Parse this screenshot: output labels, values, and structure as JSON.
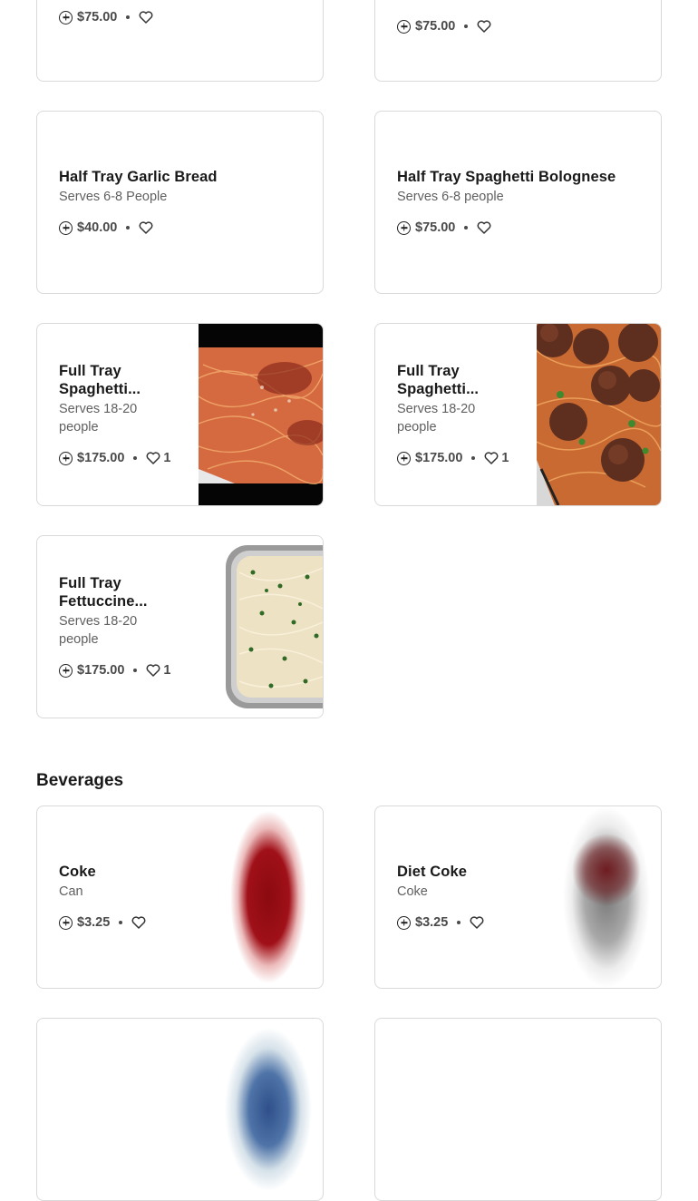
{
  "items": [
    {
      "price": "$75.00"
    },
    {
      "price": "$75.00"
    },
    {
      "title": "Half Tray Garlic Bread",
      "desc": "Serves 6-8 People",
      "price": "$40.00"
    },
    {
      "title": "Half Tray Spaghetti Bolognese",
      "desc": "Serves 6-8 people",
      "price": "$75.00"
    },
    {
      "title": "Full Tray Spaghetti...",
      "desc": "Serves 18-20 people",
      "price": "$175.00",
      "likes": "1",
      "image": "spaghetti-with-tomato-sauce-photo"
    },
    {
      "title": "Full Tray Spaghetti...",
      "desc": "Serves 18-20 people",
      "price": "$175.00",
      "likes": "1",
      "image": "spaghetti-and-meatballs-photo"
    },
    {
      "title": "Full Tray Fettuccine...",
      "desc": "Serves 18-20 people",
      "price": "$175.00",
      "likes": "1",
      "image": "fettuccine-alfredo-tray-photo"
    }
  ],
  "beverages": {
    "section_title": "Beverages",
    "items": [
      {
        "title": "Coke",
        "desc": "Can",
        "price": "$3.25",
        "image": "coke-can-photo"
      },
      {
        "title": "Diet Coke",
        "desc": "Coke",
        "price": "$3.25",
        "image": "diet-coke-can-photo"
      }
    ]
  },
  "icons": {
    "add": "plus-circle-icon",
    "favorite": "heart-icon"
  },
  "colors": {
    "border": "#d9d9d9",
    "text": "#191919",
    "muted": "#606060"
  }
}
